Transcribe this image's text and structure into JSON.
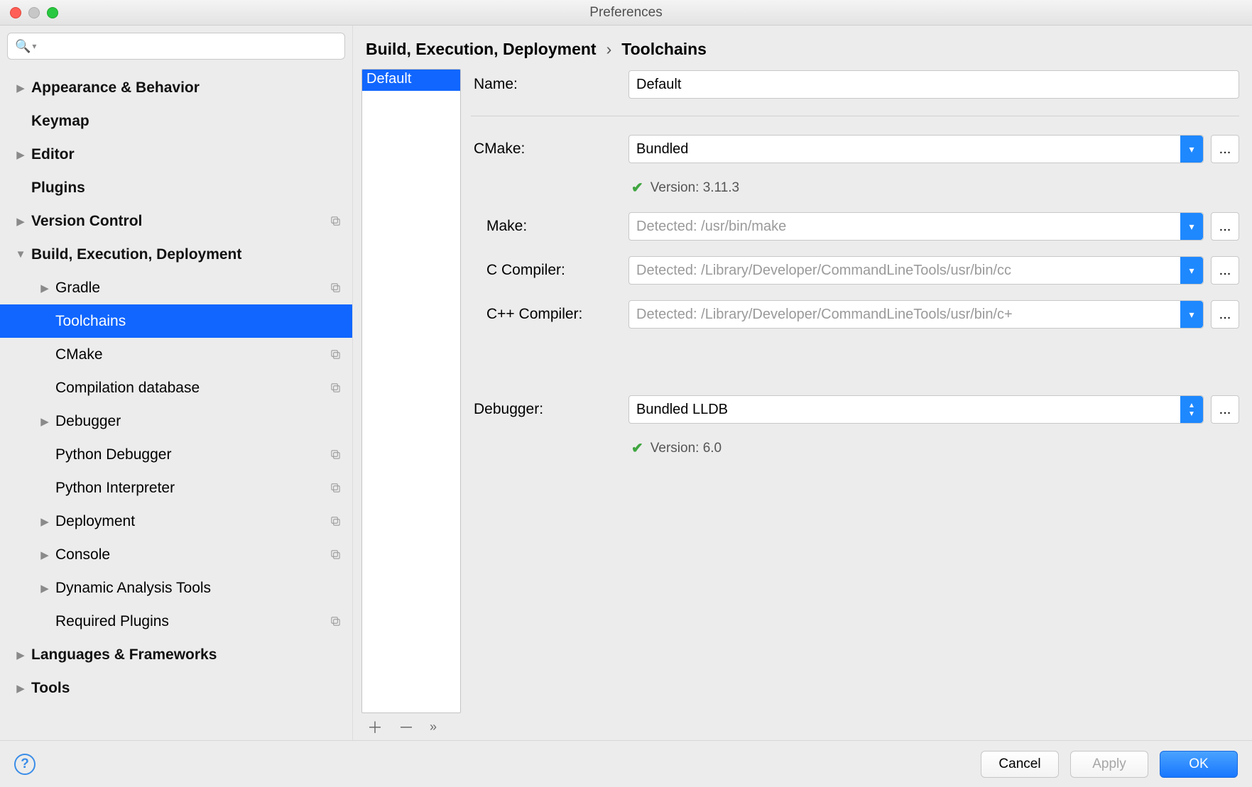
{
  "window": {
    "title": "Preferences"
  },
  "sidebar": {
    "search_placeholder": "",
    "items": [
      {
        "label": "Appearance & Behavior",
        "expandable": true
      },
      {
        "label": "Keymap"
      },
      {
        "label": "Editor",
        "expandable": true
      },
      {
        "label": "Plugins"
      },
      {
        "label": "Version Control",
        "expandable": true,
        "scoped": true
      },
      {
        "label": "Build, Execution, Deployment",
        "expandable": true,
        "expanded": true,
        "children": [
          {
            "label": "Gradle",
            "expandable": true,
            "scoped": true
          },
          {
            "label": "Toolchains",
            "selected": true
          },
          {
            "label": "CMake",
            "scoped": true
          },
          {
            "label": "Compilation database",
            "scoped": true
          },
          {
            "label": "Debugger",
            "expandable": true
          },
          {
            "label": "Python Debugger",
            "scoped": true
          },
          {
            "label": "Python Interpreter",
            "scoped": true
          },
          {
            "label": "Deployment",
            "expandable": true,
            "scoped": true
          },
          {
            "label": "Console",
            "expandable": true,
            "scoped": true
          },
          {
            "label": "Dynamic Analysis Tools",
            "expandable": true
          },
          {
            "label": "Required Plugins",
            "scoped": true
          }
        ]
      },
      {
        "label": "Languages & Frameworks",
        "expandable": true
      },
      {
        "label": "Tools",
        "expandable": true
      }
    ]
  },
  "breadcrumb": {
    "root": "Build, Execution, Deployment",
    "leaf": "Toolchains"
  },
  "toolchain_list": {
    "items": [
      "Default"
    ],
    "selected": "Default"
  },
  "form": {
    "name_label": "Name:",
    "name_value": "Default",
    "cmake_label": "CMake:",
    "cmake_value": "Bundled",
    "cmake_status": "Version: 3.11.3",
    "make_label": "Make:",
    "make_value": "Detected: /usr/bin/make",
    "cc_label": "C Compiler:",
    "cc_value": "Detected: /Library/Developer/CommandLineTools/usr/bin/cc",
    "cxx_label": "C++ Compiler:",
    "cxx_value": "Detected: /Library/Developer/CommandLineTools/usr/bin/c+",
    "debugger_label": "Debugger:",
    "debugger_value": "Bundled LLDB",
    "debugger_status": "Version: 6.0",
    "browse": "..."
  },
  "footer": {
    "cancel": "Cancel",
    "apply": "Apply",
    "ok": "OK"
  }
}
